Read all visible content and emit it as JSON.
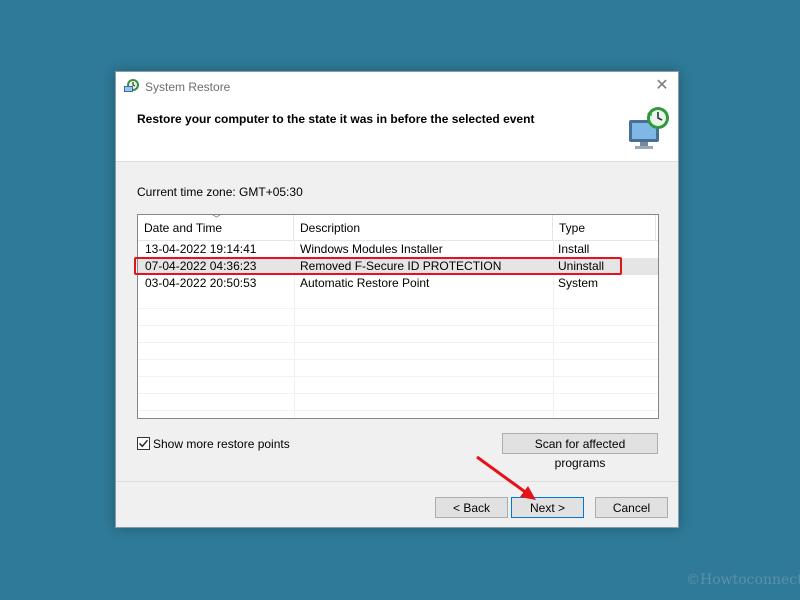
{
  "dialog": {
    "title": "System Restore",
    "heading": "Restore your computer to the state it was in before the selected event",
    "close_icon": "close-icon",
    "header_icon": "system-restore-monitor-icon",
    "timezone_label": "Current time zone: GMT+05:30"
  },
  "table": {
    "columns": [
      "Date and Time",
      "Description",
      "Type"
    ],
    "sort_icon": "sort-caret-down-icon",
    "rows": [
      {
        "date": "13-04-2022 19:14:41",
        "description": "Windows Modules Installer",
        "type": "Install"
      },
      {
        "date": "07-04-2022 04:36:23",
        "description": "Removed F-Secure ID PROTECTION",
        "type": "Uninstall"
      },
      {
        "date": "03-04-2022 20:50:53",
        "description": "Automatic Restore Point",
        "type": "System"
      }
    ],
    "selected_row": 1
  },
  "options": {
    "show_more_label": "Show more restore points",
    "show_more_checked": true
  },
  "buttons": {
    "scan": "Scan for affected programs",
    "back": "< Back",
    "next": "Next >",
    "cancel": "Cancel"
  },
  "annotation": {
    "highlight_color": "#e3121b",
    "arrow_color": "#e3121b"
  },
  "watermark": "©Howtoconnect",
  "colors": {
    "desktop": "#2e7a98",
    "accent": "#0078d7"
  }
}
